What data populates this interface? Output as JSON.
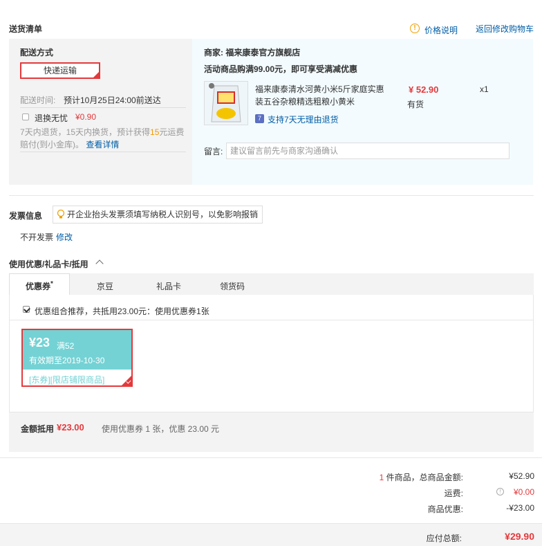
{
  "page": {
    "section_title": "送货清单",
    "price_note": "价格说明",
    "back_to_cart": "返回修改购物车"
  },
  "shipping": {
    "method_label": "配送方式",
    "method_value": "快递运输",
    "time_label": "配送时间:",
    "time_value": "预计10月25日24:00前送达",
    "return_worry": "退换无忧",
    "return_price": "¥0.90",
    "return_desc_1": "7天内退货，15天内换货，预计获得",
    "return_desc_num": "15",
    "return_desc_2": "元运费",
    "return_desc_3": "赔付(到小金库)。",
    "details_link": "查看详情"
  },
  "merchant": {
    "label": "商家:",
    "name": "福来康泰官方旗舰店",
    "promo": "活动商品购满99.00元，即可享受满减优惠"
  },
  "product": {
    "name_line1": "福来康泰清水河黄小米5斤家庭实惠",
    "name_line2": "装五谷杂粮精选粗粮小黄米",
    "price": "¥ 52.90",
    "stock": "有货",
    "qty": "x1",
    "return_badge": "7",
    "return_policy": "支持7天无理由退货"
  },
  "message": {
    "label": "留言:",
    "placeholder": "建议留言前先与商家沟通确认"
  },
  "invoice": {
    "title": "发票信息",
    "tip": "开企业抬头发票须填写纳税人识别号，以免影响报销",
    "value": "不开发票",
    "modify": "修改"
  },
  "discount": {
    "title": "使用优惠/礼品卡/抵用",
    "tabs": [
      "优惠券",
      "京豆",
      "礼品卡",
      "领货码"
    ],
    "tab_active_mark": "*",
    "combo_text": "优惠组合推荐，共抵用23.00元：使用优惠券1张"
  },
  "coupon": {
    "amount": "¥23",
    "condition": "满52",
    "expiry": "有效期至2019-10-30",
    "tag1": "[东券]",
    "tag2": "[限店铺限商品]"
  },
  "deduction": {
    "label": "金额抵用",
    "amount": "¥23.00",
    "desc": "使用优惠券 1 张，优惠 23.00 元"
  },
  "totals": {
    "count": "1",
    "count_suffix": "件商品，总商品金额:",
    "goods_amount": "¥52.90",
    "freight_label": "运费:",
    "freight_value": "¥0.00",
    "discount_label": "商品优惠:",
    "discount_value": "-¥23.00",
    "payable_label": "应付总额:",
    "payable_value": "¥29.90"
  },
  "colors": {
    "accent_red": "#e4393c",
    "link_blue": "#005ea7",
    "coupon_teal": "#74d2d4"
  }
}
